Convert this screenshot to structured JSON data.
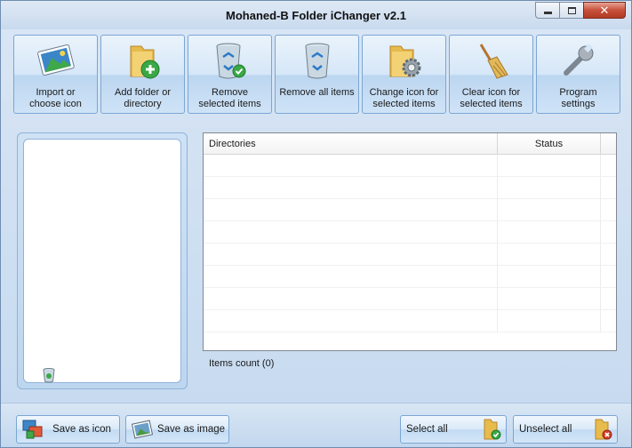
{
  "window": {
    "title": "Mohaned-B Folder iChanger v2.1",
    "close_glyph": "✕"
  },
  "toolbar": {
    "buttons": [
      {
        "label": "Import or\nchoose icon",
        "icon": "picture-icon"
      },
      {
        "label": "Add folder or\ndirectory",
        "icon": "add-folder-icon"
      },
      {
        "label": "Remove\nselected items",
        "icon": "recycle-bin-check-icon"
      },
      {
        "label": "Remove all items",
        "icon": "recycle-bin-icon"
      },
      {
        "label": "Change icon for\nselected items",
        "icon": "folder-gear-icon"
      },
      {
        "label": "Clear icon for\nselected items",
        "icon": "broom-icon"
      },
      {
        "label": "Program\nsettings",
        "icon": "wrench-icon"
      }
    ]
  },
  "list": {
    "headers": {
      "directories": "Directories",
      "status": "Status"
    },
    "rows": []
  },
  "items_count": "Items count (0)",
  "bottom": {
    "save_icon": "Save as icon",
    "save_image": "Save as image",
    "select_all": "Select all",
    "unselect_all": "Unselect all"
  },
  "colors": {
    "accent": "#7aa6d3",
    "close": "#c7503a"
  }
}
